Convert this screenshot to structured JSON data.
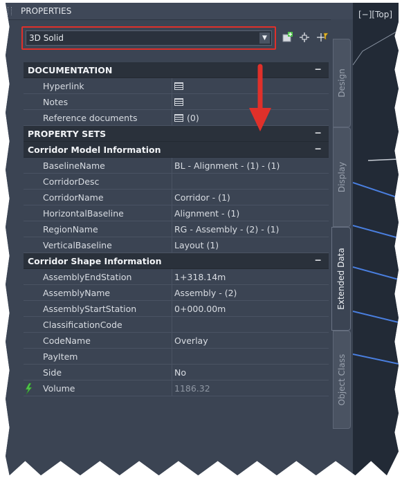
{
  "panel": {
    "title": "PROPERTIES"
  },
  "object_select": {
    "value": "3D Solid"
  },
  "toolbar_icons": [
    "add-selected-icon",
    "pick-objects-icon",
    "quick-select-icon"
  ],
  "viewport": {
    "label": "[−][Top]"
  },
  "tabs": [
    {
      "label": "Design",
      "active": false
    },
    {
      "label": "Display",
      "active": false
    },
    {
      "label": "Extended Data",
      "active": true
    },
    {
      "label": "Object Class",
      "active": false
    }
  ],
  "grid": {
    "rows": [
      {
        "type": "category",
        "name": "DOCUMENTATION",
        "collapse": "−"
      },
      {
        "type": "prop",
        "name": "Hyperlink",
        "icon": "grid-icon",
        "value": ""
      },
      {
        "type": "prop",
        "name": "Notes",
        "icon": "grid-icon",
        "value": ""
      },
      {
        "type": "prop",
        "name": "Reference documents",
        "icon": "grid-icon",
        "value": "(0)"
      },
      {
        "type": "category",
        "name": "PROPERTY SETS",
        "collapse": "−"
      },
      {
        "type": "category",
        "name": "Corridor Model Information",
        "collapse": "−"
      },
      {
        "type": "prop",
        "name": "BaselineName",
        "value": "BL - Alignment - (1) - (1)"
      },
      {
        "type": "prop",
        "name": "CorridorDesc",
        "value": ""
      },
      {
        "type": "prop",
        "name": "CorridorName",
        "value": "Corridor - (1)"
      },
      {
        "type": "prop",
        "name": "HorizontalBaseline",
        "value": "Alignment - (1)"
      },
      {
        "type": "prop",
        "name": "RegionName",
        "value": "RG - Assembly - (2) - (1)"
      },
      {
        "type": "prop",
        "name": "VerticalBaseline",
        "value": "Layout (1)"
      },
      {
        "type": "category",
        "name": "Corridor Shape Information",
        "collapse": "−"
      },
      {
        "type": "prop",
        "name": "AssemblyEndStation",
        "value": "1+318.14m"
      },
      {
        "type": "prop",
        "name": "AssemblyName",
        "value": "Assembly - (2)"
      },
      {
        "type": "prop",
        "name": "AssemblyStartStation",
        "value": "0+000.00m"
      },
      {
        "type": "prop",
        "name": "ClassificationCode",
        "value": ""
      },
      {
        "type": "prop",
        "name": "CodeName",
        "value": "Overlay"
      },
      {
        "type": "prop",
        "name": "PayItem",
        "value": ""
      },
      {
        "type": "prop",
        "name": "Side",
        "value": "No"
      },
      {
        "type": "prop",
        "name": "Volume",
        "value": "1186.32",
        "readonly": true,
        "icon": "formula-icon"
      }
    ]
  },
  "colors": {
    "panel_bg": "#3b4453",
    "category_bg": "#2a313b",
    "highlight_border": "#e0302a",
    "arrow": "#e0302a",
    "viewport_bg": "#222a36",
    "viewport_lines": "#4a7fe0"
  }
}
